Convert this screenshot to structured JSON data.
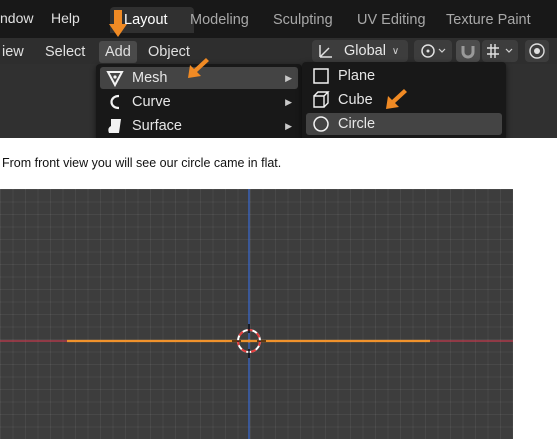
{
  "topbar": {
    "menus": [
      "ndow",
      "Help"
    ],
    "workspace_tabs": [
      "Layout",
      "Modeling",
      "Sculpting",
      "UV Editing",
      "Texture Paint"
    ],
    "active_tab": "Layout"
  },
  "header": {
    "menus": [
      "iew",
      "Select",
      "Add",
      "Object"
    ],
    "active_menu": "Add",
    "orientation": "Global"
  },
  "add_menu": {
    "items": [
      {
        "label": "Mesh",
        "icon": "mesh-icon",
        "has_submenu": true
      },
      {
        "label": "Curve",
        "icon": "curve-icon",
        "has_submenu": true
      },
      {
        "label": "Surface",
        "icon": "surface-icon",
        "has_submenu": true
      }
    ],
    "highlighted": "Mesh"
  },
  "mesh_submenu": {
    "items": [
      {
        "label": "Plane",
        "icon": "plane-icon"
      },
      {
        "label": "Cube",
        "icon": "cube-icon"
      },
      {
        "label": "Circle",
        "icon": "circle-icon"
      }
    ],
    "highlighted": "Circle"
  },
  "caption": "From front view you will see our circle came in flat.",
  "colors": {
    "blender_dark": "#181818",
    "blender_panel": "#303030",
    "highlight": "#444444",
    "arrow_orange": "#f08a24",
    "x_axis": "#c23a4c",
    "z_axis": "#3a66c8",
    "selected_edge": "#f0922c"
  }
}
